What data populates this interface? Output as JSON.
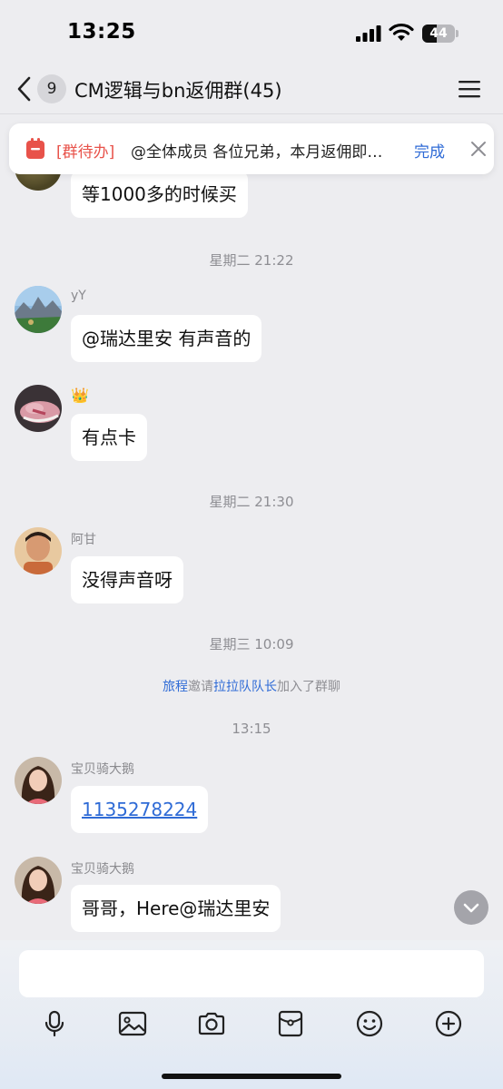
{
  "status_bar": {
    "time": "13:25",
    "battery": "44",
    "battery_level": 0.44
  },
  "nav": {
    "unread_count": "9",
    "title": "CM逻辑与bn返佣群(45)"
  },
  "todo_banner": {
    "tag": "[群待办]",
    "text": "@全体成员 各位兄弟，本月返佣即将发放",
    "done_label": "完成",
    "accent_color": "#e8524a"
  },
  "messages": [
    {
      "sender": "",
      "text": "等1000多的时候买"
    },
    {
      "timestamp": "星期二 21:22"
    },
    {
      "sender": "yY",
      "text": "@瑞达里安 有声音的"
    },
    {
      "sender": "👑",
      "text": "有点卡"
    },
    {
      "timestamp": "星期二 21:30"
    },
    {
      "sender": "阿甘",
      "text": "没得声音呀"
    },
    {
      "timestamp": "星期三 10:09"
    },
    {
      "system": {
        "inviter": "旅程",
        "verb": "邀请",
        "invitee": "拉拉队队长",
        "suffix": "加入了群聊"
      }
    },
    {
      "timestamp": "13:15"
    },
    {
      "sender": "宝贝骑大鹅",
      "text": "1135278224",
      "is_link": true
    },
    {
      "sender": "宝贝骑大鹅",
      "text": "哥哥，Here@瑞达里安"
    }
  ],
  "input": {
    "placeholder": ""
  },
  "toolbar_icons": [
    "microphone-icon",
    "image-icon",
    "camera-icon",
    "red-packet-icon",
    "emoji-icon",
    "plus-icon"
  ],
  "colors": {
    "link": "#2f6bd6",
    "background": "#ededf0"
  }
}
